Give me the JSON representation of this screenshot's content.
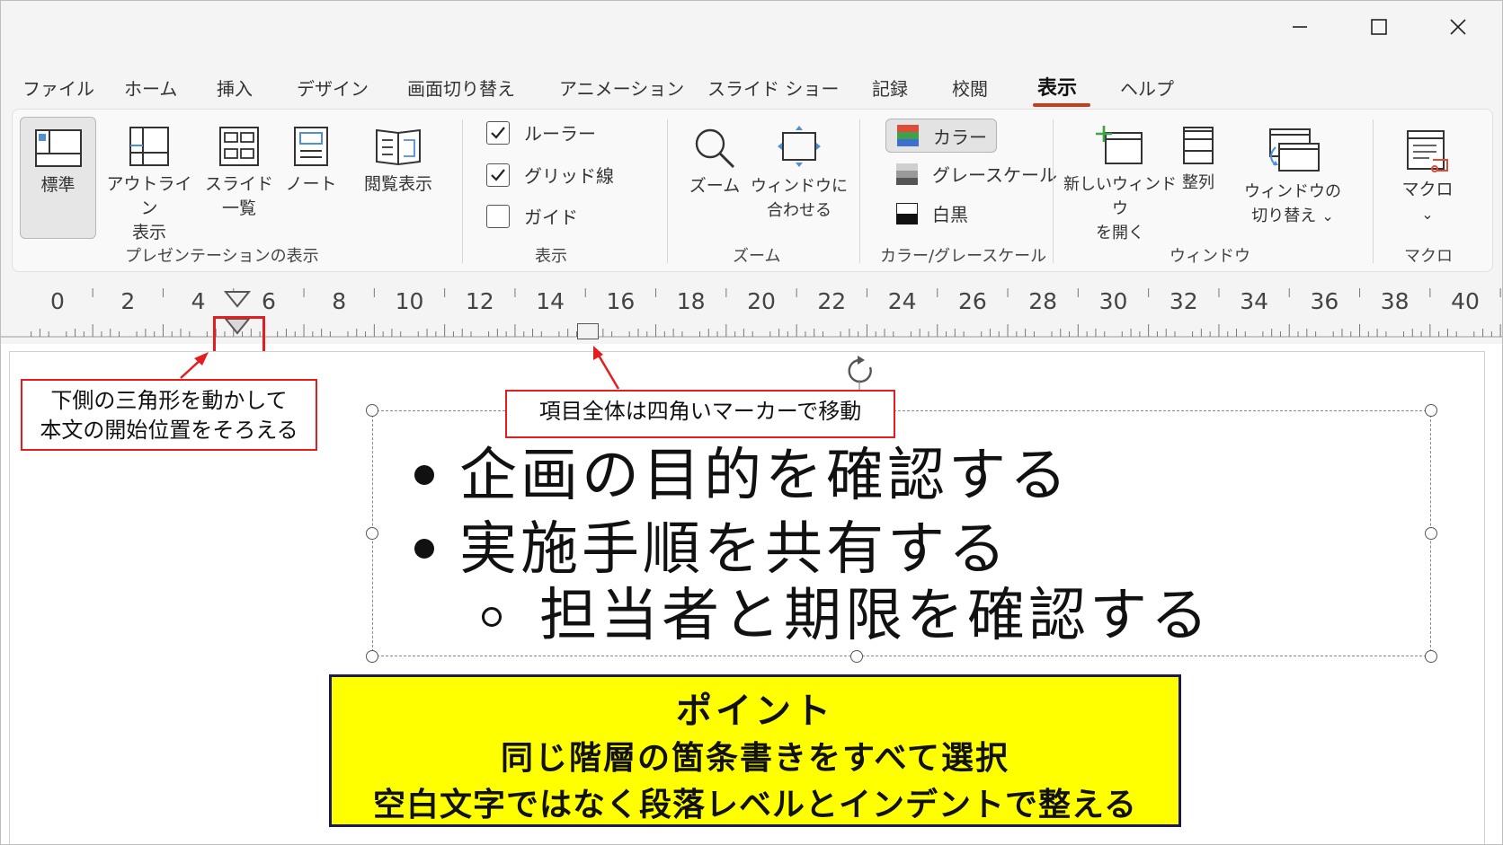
{
  "window": {
    "controls": [
      "minimize-icon",
      "maximize-icon",
      "close-icon"
    ]
  },
  "tabs": [
    {
      "label": "ファイル"
    },
    {
      "label": "ホーム"
    },
    {
      "label": "挿入"
    },
    {
      "label": "デザイン"
    },
    {
      "label": "画面切り替え"
    },
    {
      "label": "アニメーション"
    },
    {
      "label": "スライド ショー"
    },
    {
      "label": "記録"
    },
    {
      "label": "校閲"
    },
    {
      "label": "表示",
      "active": true
    },
    {
      "label": "ヘルプ"
    }
  ],
  "accent_color": "#c43e1c",
  "ribbon": {
    "presentation_views": {
      "group_label": "プレゼンテーションの表示",
      "normal": "標準",
      "outline_1": "アウトライン",
      "outline_2": "表示",
      "sorter_1": "スライド",
      "sorter_2": "一覧",
      "notes": "ノート",
      "reading": "閲覧表示"
    },
    "show": {
      "group_label": "表示",
      "ruler": {
        "label": "ルーラー",
        "checked": true
      },
      "gridlines": {
        "label": "グリッド線",
        "checked": true
      },
      "guides": {
        "label": "ガイド",
        "checked": false
      }
    },
    "zoom": {
      "group_label": "ズーム",
      "zoom": "ズーム",
      "fit_1": "ウィンドウに",
      "fit_2": "合わせる"
    },
    "color": {
      "group_label": "カラー/グレースケール",
      "color": "カラー",
      "grayscale": "グレースケール",
      "bw": "白黒"
    },
    "window": {
      "group_label": "ウィンドウ",
      "new_1": "新しいウィンドウ",
      "new_2": "を開く",
      "arrange": "整列",
      "switch_1": "ウィンドウの",
      "switch_2": "切り替え",
      "chevron": "⌄"
    },
    "macros": {
      "group_label": "マクロ",
      "macros": "マクロ",
      "chevron": "⌄"
    }
  },
  "ruler": {
    "numbers": [
      "0",
      "2",
      "4",
      "6",
      "8",
      "10",
      "12",
      "14",
      "16",
      "18",
      "20",
      "22",
      "24",
      "26",
      "28",
      "30",
      "32",
      "34",
      "36",
      "38",
      "40"
    ]
  },
  "slide": {
    "callout_left_1": "下側の三角形を動かして",
    "callout_left_2": "本文の開始位置をそろえる",
    "callout_top": "項目全体は四角いマーカーで移動",
    "bullets": [
      "企画の目的を確認する",
      "実施手順を共有する",
      "担当者と期限を確認する"
    ],
    "point_title": "ポイント",
    "point_line1": "同じ階層の箇条書きをすべて選択",
    "point_line2": "空白文字ではなく段落レベルとインデントで整える",
    "colors": {
      "callout_border": "#e41e1e",
      "point_bg": "#ffff00",
      "point_border": "#1a1a55"
    }
  }
}
